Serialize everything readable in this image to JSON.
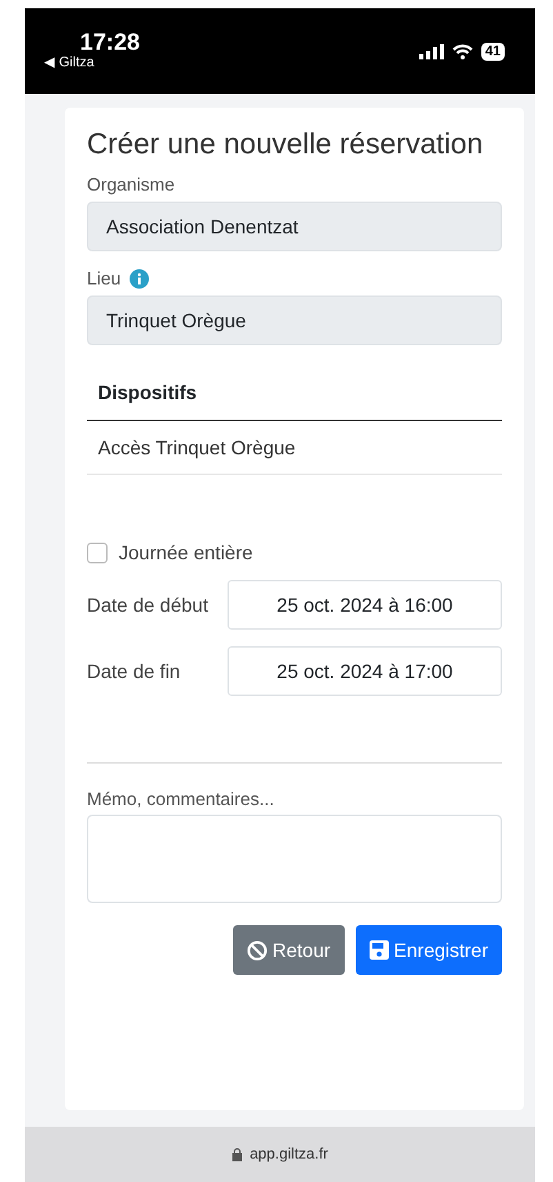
{
  "status_bar": {
    "time": "17:28",
    "back_app": "◀ Giltza",
    "battery": "41"
  },
  "form": {
    "title": "Créer une nouvelle réservation",
    "organisme": {
      "label": "Organisme",
      "value": "Association Denentzat"
    },
    "lieu": {
      "label": "Lieu",
      "value": "Trinquet Orègue"
    },
    "dispositifs": {
      "heading": "Dispositifs",
      "rows": [
        "Accès Trinquet Orègue"
      ]
    },
    "all_day": {
      "label": "Journée entière",
      "checked": false
    },
    "dates": [
      {
        "label": "Date de début",
        "value": "25 oct. 2024 à 16:00"
      },
      {
        "label": "Date de fin",
        "value": "25 oct. 2024 à 17:00"
      }
    ],
    "memo": {
      "label": "Mémo, commentaires..."
    },
    "buttons": [
      {
        "kind": "cancel",
        "label": "Retour"
      },
      {
        "kind": "save",
        "label": "Enregistrer"
      }
    ]
  },
  "address_bar": {
    "url": "app.giltza.fr"
  }
}
